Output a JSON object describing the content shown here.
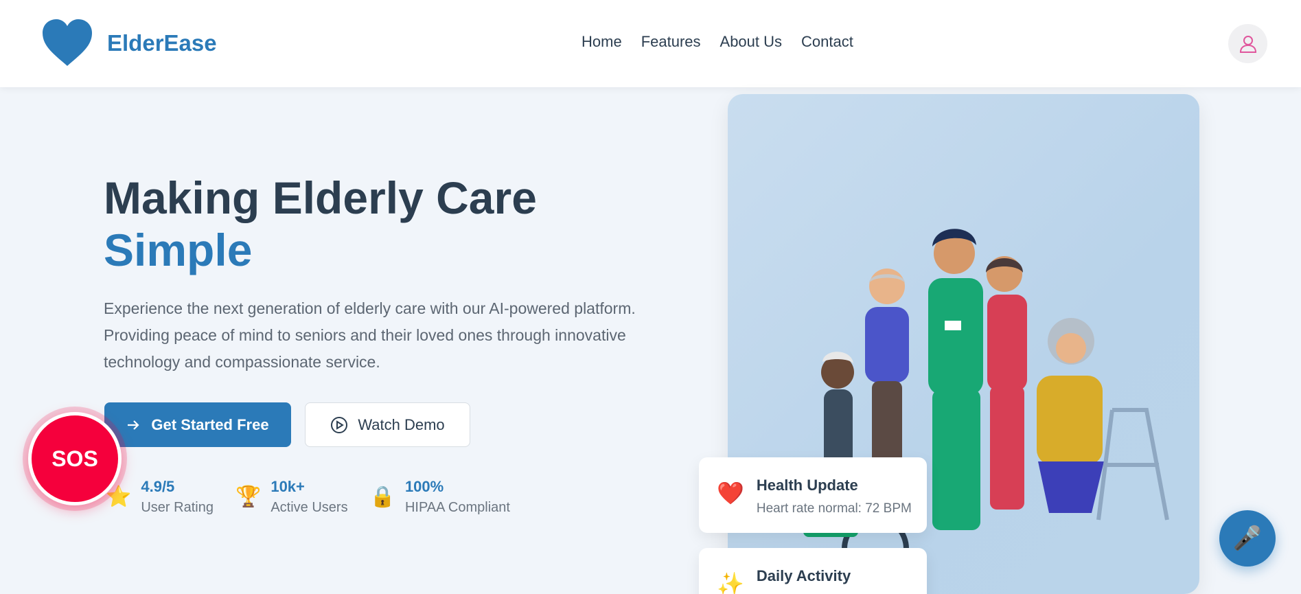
{
  "brand": {
    "name": "ElderEase",
    "logo_icon": "heart-icon",
    "color": "#2b7ab8"
  },
  "nav": {
    "links": [
      "Home",
      "Features",
      "About Us",
      "Contact"
    ],
    "user_icon": "user-icon"
  },
  "hero": {
    "title_line1": "Making Elderly Care",
    "title_line2": "Simple",
    "description": "Experience the next generation of elderly care with our AI-powered platform. Providing peace of mind to seniors and their loved ones through innovative technology and compassionate service.",
    "primary_button": "Get Started Free",
    "primary_button_icon": "arrow-right-icon",
    "secondary_button": "Watch Demo",
    "secondary_button_icon": "play-circle-icon"
  },
  "stats": [
    {
      "icon": "⭐",
      "value": "4.9/5",
      "label": "User Rating"
    },
    {
      "icon": "🏆",
      "value": "10k+",
      "label": "Active Users"
    },
    {
      "icon": "🔒",
      "value": "100%",
      "label": "HIPAA Compliant"
    }
  ],
  "sos": {
    "label": "SOS",
    "color": "#f5003c"
  },
  "cards": [
    {
      "icon": "❤️",
      "title": "Health Update",
      "subtitle": "Heart rate normal: 72 BPM"
    },
    {
      "icon": "✨",
      "title": "Daily Activity",
      "subtitle": ""
    }
  ],
  "voice_fab": {
    "icon": "🎤"
  }
}
